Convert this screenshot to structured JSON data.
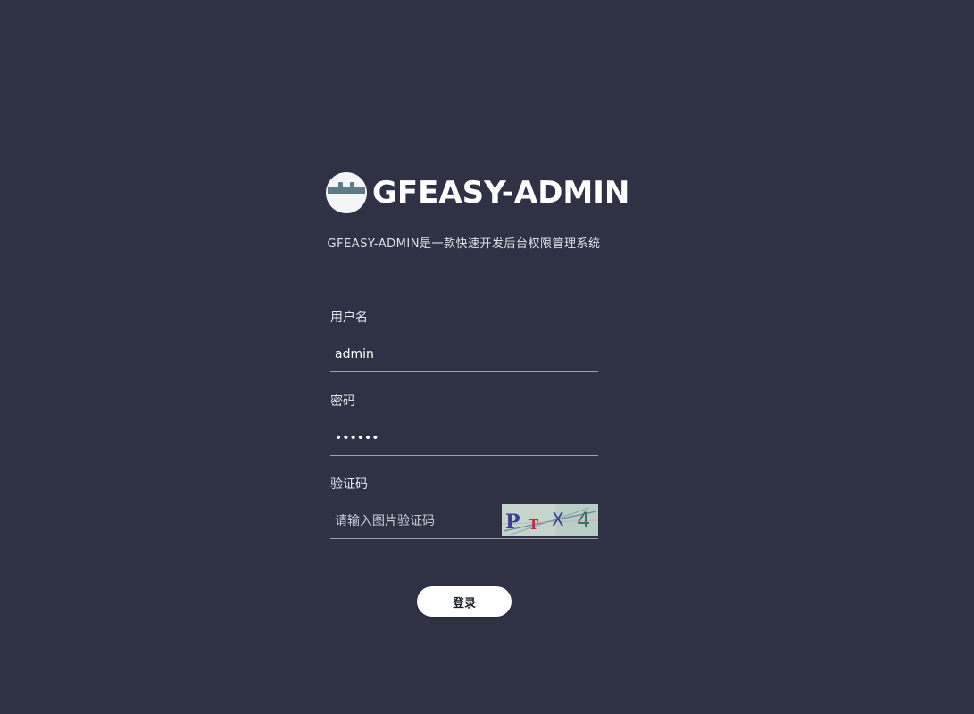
{
  "brand": {
    "title": "GFEASY-ADMIN",
    "logo_icon": "robot-face-icon"
  },
  "subtitle": "GFEASY-ADMIN是一款快速开发后台权限管理系统",
  "form": {
    "username": {
      "label": "用户名",
      "value": "admin",
      "placeholder": ""
    },
    "password": {
      "label": "密码",
      "value": "123456",
      "placeholder": ""
    },
    "captcha": {
      "label": "验证码",
      "value": "",
      "placeholder": "请输入图片验证码",
      "image_text": [
        "P",
        "T",
        "X",
        "4"
      ],
      "image_colors": [
        "#3b3f9a",
        "#c0284a",
        "#3b3f9a",
        "#3f6f6a"
      ]
    },
    "submit_label": "登录"
  },
  "colors": {
    "background": "#2e3244",
    "button_bg": "#ffffff",
    "captcha_bg": "#c4d6c9"
  }
}
